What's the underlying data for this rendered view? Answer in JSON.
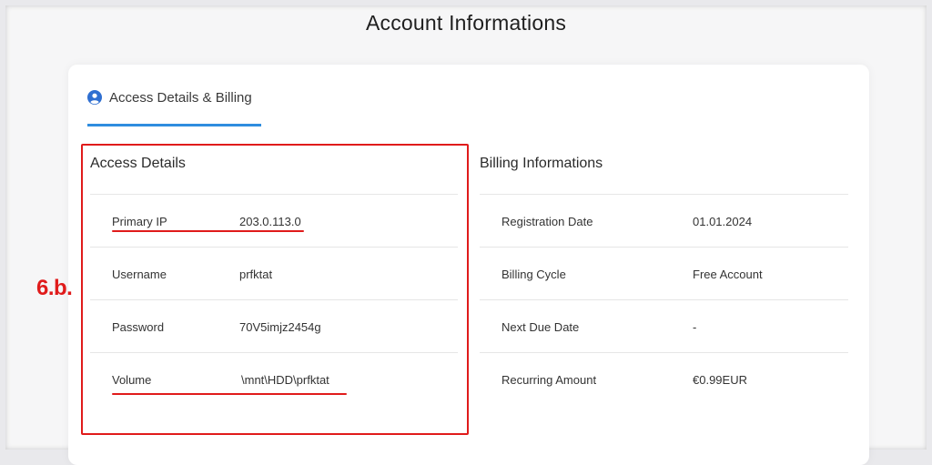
{
  "page_title": "Account Informations",
  "tab": {
    "label": "Access Details & Billing",
    "icon": "user-circle-icon"
  },
  "access_details": {
    "title": "Access Details",
    "rows": [
      {
        "label": "Primary IP",
        "value": "203.0.113.0"
      },
      {
        "label": "Username",
        "value": "prfktat"
      },
      {
        "label": "Password",
        "value": "70V5imjz2454g"
      },
      {
        "label": "Volume",
        "value": "\\mnt\\HDD\\prfktat"
      }
    ]
  },
  "billing": {
    "title": "Billing Informations",
    "rows": [
      {
        "label": "Registration Date",
        "value": "01.01.2024"
      },
      {
        "label": "Billing Cycle",
        "value": "Free Account"
      },
      {
        "label": "Next Due Date",
        "value": "-"
      },
      {
        "label": "Recurring Amount",
        "value": "€0.99EUR"
      }
    ]
  },
  "annotation": {
    "label": "6.b.",
    "color": "#e01b1b"
  },
  "colors": {
    "accent": "#2f8ddf",
    "highlight": "#e01b1b"
  }
}
